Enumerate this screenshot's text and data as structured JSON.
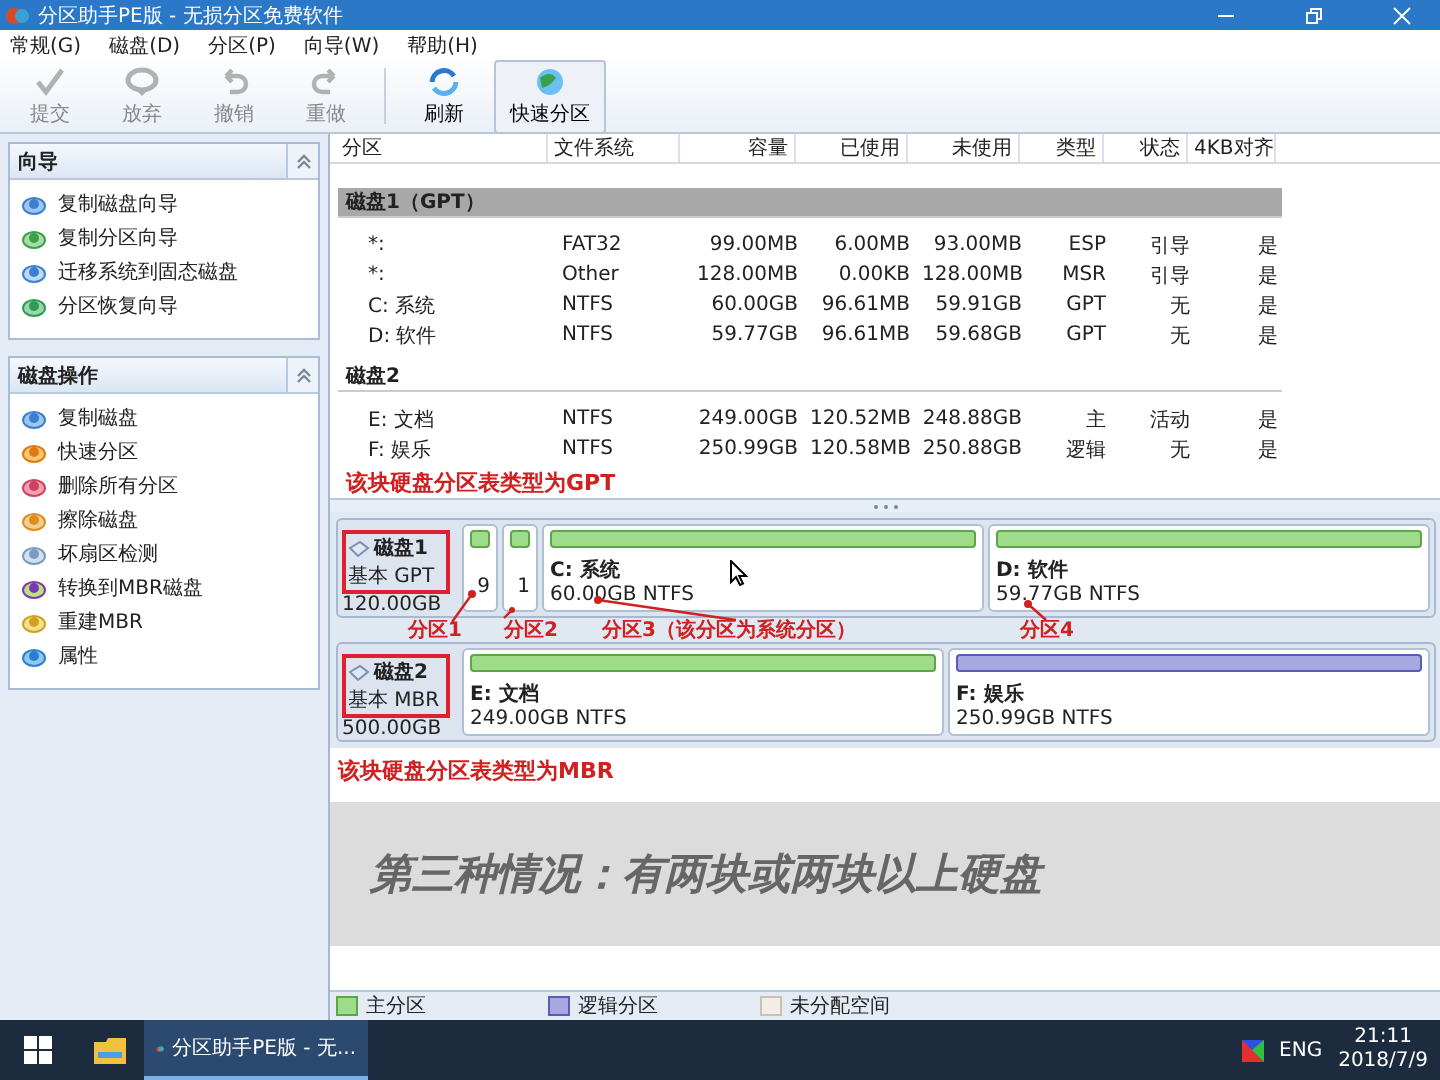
{
  "window": {
    "title": "分区助手PE版 - 无损分区免费软件"
  },
  "menu": [
    "常规(G)",
    "磁盘(D)",
    "分区(P)",
    "向导(W)",
    "帮助(H)"
  ],
  "toolbar": [
    {
      "label": "提交",
      "kind": "check",
      "disabled": true,
      "selected": false
    },
    {
      "label": "放弃",
      "kind": "discard",
      "disabled": true,
      "selected": false
    },
    {
      "label": "撤销",
      "kind": "undo",
      "disabled": true,
      "selected": false
    },
    {
      "label": "重做",
      "kind": "redo",
      "disabled": true,
      "selected": false
    },
    {
      "label": "刷新",
      "kind": "refresh",
      "disabled": false,
      "selected": false
    },
    {
      "label": "快速分区",
      "kind": "quick",
      "disabled": false,
      "selected": true
    }
  ],
  "sidebar": [
    {
      "title": "向导",
      "expanded": true,
      "items": [
        {
          "label": "复制磁盘向导",
          "kind": "copy"
        },
        {
          "label": "复制分区向导",
          "kind": "wizard"
        },
        {
          "label": "迁移系统到固态磁盘",
          "kind": "migrate"
        },
        {
          "label": "分区恢复向导",
          "kind": "recover"
        }
      ]
    },
    {
      "title": "磁盘操作",
      "expanded": true,
      "items": [
        {
          "label": "复制磁盘",
          "kind": "copy"
        },
        {
          "label": "快速分区",
          "kind": "quick"
        },
        {
          "label": "删除所有分区",
          "kind": "delete"
        },
        {
          "label": "擦除磁盘",
          "kind": "wipe"
        },
        {
          "label": "坏扇区检测",
          "kind": "scan"
        },
        {
          "label": "转换到MBR磁盘",
          "kind": "convert"
        },
        {
          "label": "重建MBR",
          "kind": "rebuild"
        },
        {
          "label": "属性",
          "kind": "props"
        }
      ]
    }
  ],
  "table": {
    "columns": [
      "分区",
      "文件系统",
      "容量",
      "已使用",
      "未使用",
      "类型",
      "状态",
      "4KB对齐"
    ],
    "disks": [
      {
        "name": "磁盘1（GPT）",
        "selected": true,
        "rows": [
          [
            "*:",
            "FAT32",
            "99.00MB",
            "6.00MB",
            "93.00MB",
            "ESP",
            "引导",
            "是"
          ],
          [
            "*:",
            "Other",
            "128.00MB",
            "0.00KB",
            "128.00MB",
            "MSR",
            "引导",
            "是"
          ],
          [
            "C: 系统",
            "NTFS",
            "60.00GB",
            "96.61MB",
            "59.91GB",
            "GPT",
            "无",
            "是"
          ],
          [
            "D: 软件",
            "NTFS",
            "59.77GB",
            "96.61MB",
            "59.68GB",
            "GPT",
            "无",
            "是"
          ]
        ]
      },
      {
        "name": "磁盘2",
        "selected": false,
        "rows": [
          [
            "E: 文档",
            "NTFS",
            "249.00GB",
            "120.52MB",
            "248.88GB",
            "主",
            "活动",
            "是"
          ],
          [
            "F: 娱乐",
            "NTFS",
            "250.99GB",
            "120.58MB",
            "250.88GB",
            "逻辑",
            "无",
            "是"
          ]
        ]
      }
    ]
  },
  "gpt_note": "该块硬盘分区表类型为GPT",
  "disk_map": [
    {
      "name": "磁盘1",
      "type": "基本 GPT",
      "size": "120.00GB",
      "partitions": [
        {
          "kind": "primary",
          "detail": "9"
        },
        {
          "kind": "primary",
          "detail": "1"
        },
        {
          "kind": "primary",
          "label": "C: 系统",
          "detail": "60.00GB NTFS"
        },
        {
          "kind": "primary",
          "label": "D: 软件",
          "detail": "59.77GB NTFS"
        }
      ]
    },
    {
      "name": "磁盘2",
      "type": "基本 MBR",
      "size": "500.00GB",
      "partitions": [
        {
          "kind": "primary",
          "label": "E: 文档",
          "detail": "249.00GB NTFS"
        },
        {
          "kind": "logical",
          "label": "F: 娱乐",
          "detail": "250.99GB NTFS"
        }
      ]
    }
  ],
  "annotations": [
    "分区1",
    "分区2",
    "分区3（该分区为系统分区）",
    "分区4"
  ],
  "mbr_note": "该块硬盘分区表类型为MBR",
  "banner": "第三种情况：有两块或两块以上硬盘",
  "legend": [
    {
      "label": "主分区",
      "kind": "primary"
    },
    {
      "label": "逻辑分区",
      "kind": "logical"
    },
    {
      "label": "未分配空间",
      "kind": "free"
    }
  ],
  "taskbar": {
    "app": "分区助手PE版 - 无...",
    "language": "ENG",
    "time": "21:11",
    "date": "2018/7/9"
  }
}
